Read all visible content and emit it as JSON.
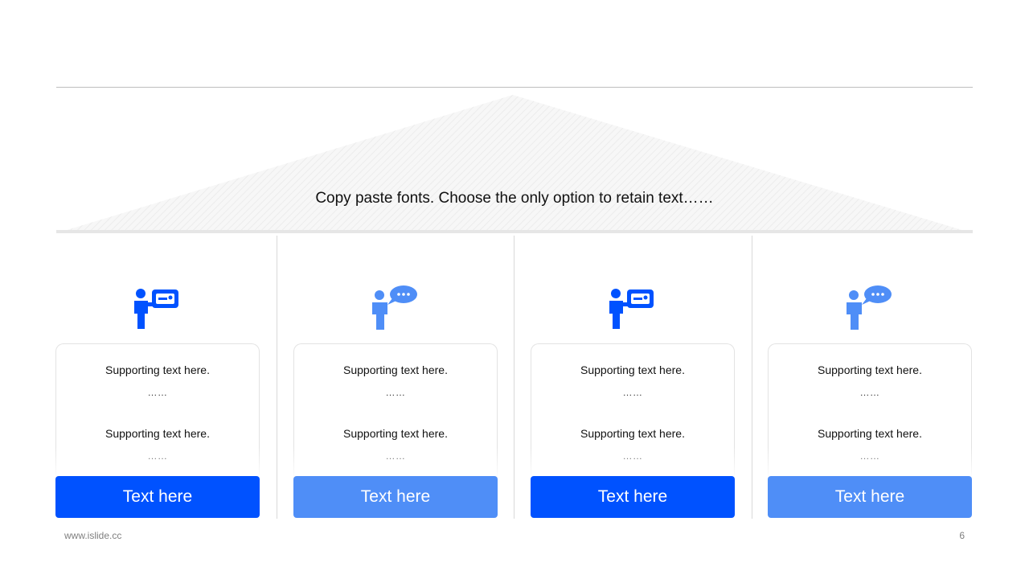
{
  "banner": {
    "text": "Copy paste fonts. Choose the only option to retain text……"
  },
  "columns": [
    {
      "icon": "presenter-board-icon",
      "icon_color": "#0052ff",
      "line1": "Supporting  text here.",
      "dots1": "……",
      "line2": "Supporting  text here.",
      "dots2": "……",
      "button": "Text  here",
      "button_color": "#0052ff"
    },
    {
      "icon": "speaker-chat-icon",
      "icon_color": "#4f8ef7",
      "line1": "Supporting  text here.",
      "dots1": "……",
      "line2": "Supporting  text here.",
      "dots2": "……",
      "button": "Text  here",
      "button_color": "#4f8ef7"
    },
    {
      "icon": "presenter-board-icon",
      "icon_color": "#0052ff",
      "line1": "Supporting  text here.",
      "dots1": "……",
      "line2": "Supporting  text here.",
      "dots2": "……",
      "button": "Text  here",
      "button_color": "#0052ff"
    },
    {
      "icon": "speaker-chat-icon",
      "icon_color": "#4f8ef7",
      "line1": "Supporting  text here.",
      "dots1": "……",
      "line2": "Supporting  text here.",
      "dots2": "……",
      "button": "Text  here",
      "button_color": "#4f8ef7"
    }
  ],
  "footer": {
    "url": "www.islide.cc",
    "page": "6"
  }
}
